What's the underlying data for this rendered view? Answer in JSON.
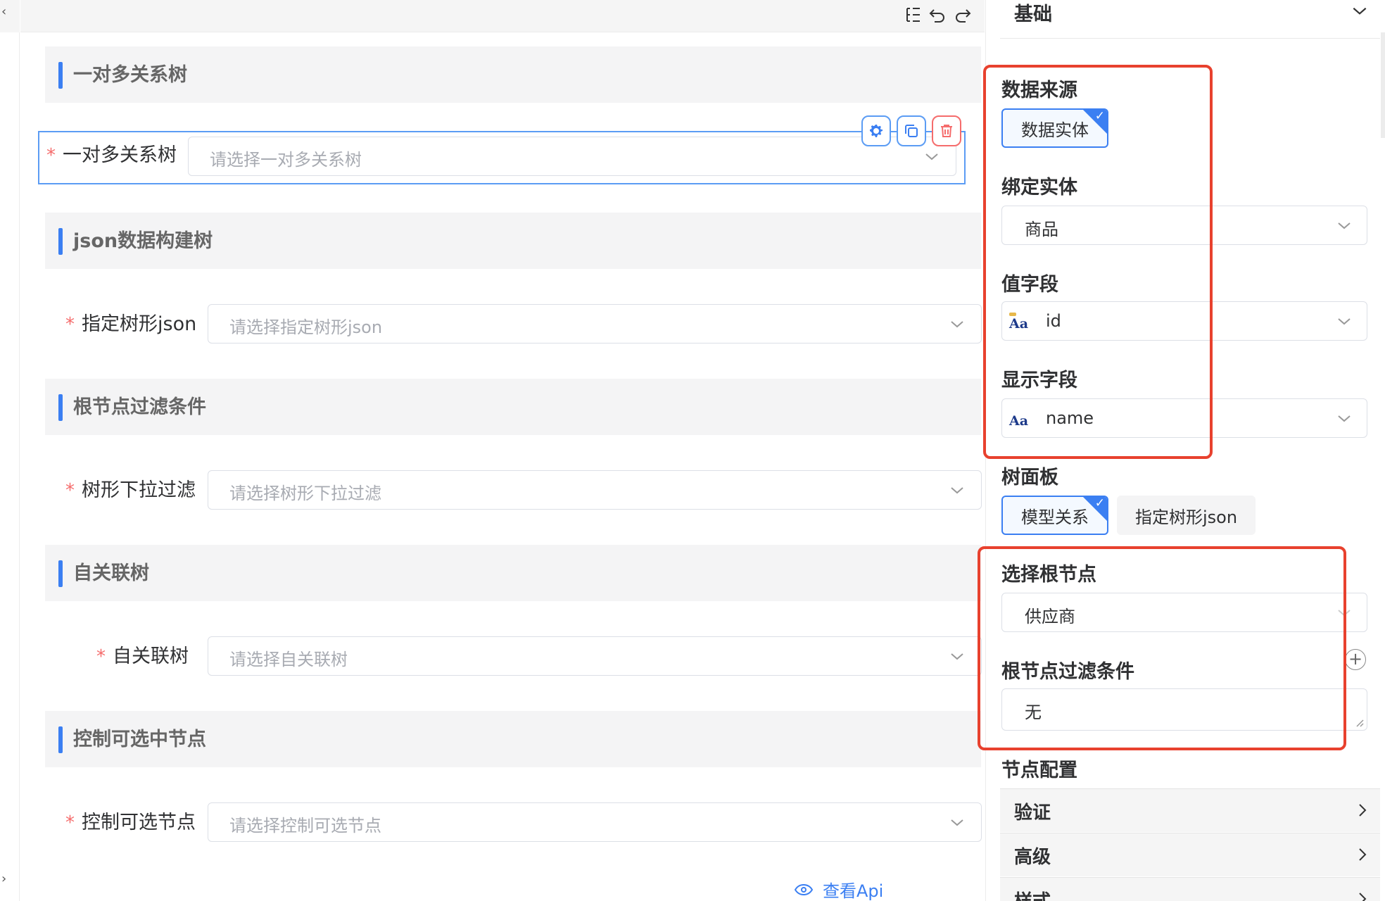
{
  "canvas": {
    "sections": [
      {
        "title": "一对多关系树"
      },
      {
        "title": "json数据构建树"
      },
      {
        "title": "根节点过滤条件"
      },
      {
        "title": "自关联树"
      },
      {
        "title": "控制可选中节点"
      }
    ],
    "fields": [
      {
        "label": "一对多关系树",
        "placeholder": "请选择一对多关系树",
        "required": "*"
      },
      {
        "label": "指定树形json",
        "placeholder": "请选择指定树形json",
        "required": "*"
      },
      {
        "label": "树形下拉过滤",
        "placeholder": "请选择树形下拉过滤",
        "required": "*"
      },
      {
        "label": "自关联树",
        "placeholder": "请选择自关联树",
        "required": "*"
      },
      {
        "label": "控制可选节点",
        "placeholder": "请选择控制可选节点",
        "required": "*"
      }
    ],
    "api_link": "查看Api"
  },
  "panel": {
    "header": "基础",
    "data_source": {
      "label": "数据来源",
      "option": "数据实体",
      "tick": "✓"
    },
    "bind_entity": {
      "label": "绑定实体",
      "value": "商品"
    },
    "value_field": {
      "label": "值字段",
      "value": "id",
      "type_icon": "Aa"
    },
    "display_field": {
      "label": "显示字段",
      "value": "name",
      "type_icon": "Aa"
    },
    "tree_panel": {
      "label": "树面板",
      "options": [
        "模型关系",
        "指定树形json"
      ],
      "tick": "✓"
    },
    "root_node": {
      "label": "选择根节点",
      "value": "供应商"
    },
    "root_filter": {
      "label": "根节点过滤条件",
      "value": "无",
      "add": "+"
    },
    "node_config": {
      "label": "节点配置"
    },
    "accordion": [
      "验证",
      "高级",
      "样式"
    ]
  },
  "colors": {
    "accent": "#3b7ff2",
    "danger": "#f56c6c",
    "highlight": "#e8412e"
  }
}
